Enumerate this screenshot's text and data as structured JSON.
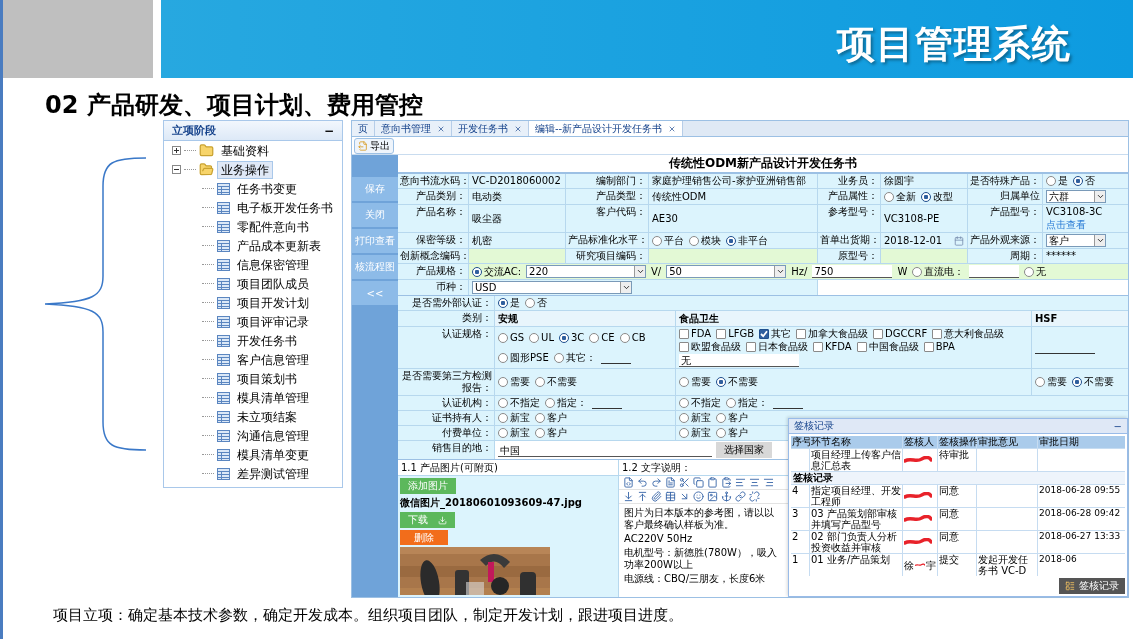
{
  "slide": {
    "banner_title": "项目管理系统",
    "heading": "02 产品研发、项目计划、费用管控",
    "caption": "项目立项：确定基本技术参数，确定开发成本。组织项目团队，制定开发计划，跟进项目进度。"
  },
  "tree": {
    "title": "立项阶段",
    "collapse_glyph": "−",
    "items": [
      {
        "label": "基础资料",
        "expanded": false,
        "selected": false
      },
      {
        "label": "业务操作",
        "expanded": true,
        "selected": true,
        "children": [
          {
            "label": "任务书变更"
          },
          {
            "label": "电子板开发任务书"
          },
          {
            "label": "零配件意向书"
          },
          {
            "label": "产品成本更新表"
          },
          {
            "label": "信息保密管理"
          },
          {
            "label": "项目团队成员"
          },
          {
            "label": "项目开发计划"
          },
          {
            "label": "项目评审记录"
          },
          {
            "label": "开发任务书"
          },
          {
            "label": "客户信息管理"
          },
          {
            "label": "项目策划书"
          },
          {
            "label": "模具清单管理"
          },
          {
            "label": "未立项结案"
          },
          {
            "label": "沟通信息管理"
          },
          {
            "label": "模具清单变更"
          },
          {
            "label": "差异测试管理"
          }
        ]
      }
    ]
  },
  "app": {
    "tabs": [
      {
        "label": "页",
        "closable": false,
        "selected": false
      },
      {
        "label": "意向书管理",
        "closable": true,
        "selected": false
      },
      {
        "label": "开发任务书",
        "closable": true,
        "selected": false
      },
      {
        "label": "编辑--新产品设计开发任务书",
        "closable": true,
        "selected": true
      }
    ],
    "export_button": "导出",
    "title": "传统性ODM新产品设计开发任务书",
    "side_buttons": [
      "保存",
      "关闭",
      "打印查看",
      "核流程图",
      "<<"
    ],
    "field_rows": [
      [
        {
          "label": "意向书流水码：",
          "kind": "text",
          "value": "VC-D2018060002"
        },
        {
          "label": "编制部门：",
          "kind": "text",
          "value": "家庭护理销售公司-家护亚洲销售部"
        },
        {
          "label": "业务员：",
          "kind": "text",
          "value": "徐圆宇"
        },
        {
          "label": "是否特殊产品：",
          "kind": "radio",
          "options": [
            {
              "label": "是",
              "selected": false
            },
            {
              "label": "否",
              "selected": true
            }
          ]
        }
      ],
      [
        {
          "label": "产品类别：",
          "kind": "text",
          "value": "电动类"
        },
        {
          "label": "产品类型：",
          "kind": "text",
          "value": "传统性ODM"
        },
        {
          "label": "产品属性：",
          "kind": "radio",
          "options": [
            {
              "label": "全新",
              "selected": false
            },
            {
              "label": "改型",
              "selected": true
            }
          ]
        },
        {
          "label": "归属单位",
          "kind": "select",
          "value": "六群"
        }
      ],
      [
        {
          "label": "产品名称：",
          "kind": "text",
          "value": "吸尘器"
        },
        {
          "label": "客户代码：",
          "kind": "text",
          "value": "AE30"
        },
        {
          "label": "参考型号：",
          "kind": "text",
          "value": "VC3108-PE"
        },
        {
          "label": "产品型号：",
          "kind": "text",
          "value": "VC3108-3C",
          "link": "点击查看"
        }
      ],
      [
        {
          "label": "保密等级：",
          "kind": "text",
          "value": "机密"
        },
        {
          "label": "产品标准化水平：",
          "kind": "radio",
          "options": [
            {
              "label": "平台",
              "selected": false
            },
            {
              "label": "模块",
              "selected": false
            },
            {
              "label": "非平台",
              "selected": true
            }
          ]
        },
        {
          "label": "首单出货期：",
          "kind": "date",
          "value": "2018-12-01"
        },
        {
          "label": "产品外观来源：",
          "kind": "select",
          "value": "客户"
        }
      ],
      [
        {
          "label": "创新概念编码：",
          "kind": "text"
        },
        {
          "label": "研究项目编码：",
          "kind": "text"
        },
        {
          "label": "原型号：",
          "kind": "text"
        },
        {
          "label": "周期：",
          "kind": "text",
          "value": "******"
        }
      ]
    ],
    "spec": {
      "label": "产品规格：",
      "ac": {
        "label": "交流AC:",
        "selected": true
      },
      "voltage": "220",
      "volt_unit": "V/",
      "frequency": "50",
      "freq_unit": "Hz/",
      "power": "750",
      "power_unit": "W",
      "dc": {
        "label": "直流电：",
        "selected": false
      },
      "none": {
        "label": "无",
        "selected": false
      }
    },
    "currency": {
      "label": "币种：",
      "value": "USD"
    },
    "certification": {
      "external": {
        "label": "是否需外部认证：",
        "options": [
          {
            "label": "是",
            "selected": true
          },
          {
            "label": "否",
            "selected": false
          }
        ]
      },
      "category_label": "类别：",
      "columns": [
        "安规",
        "食品卫生",
        "HSF"
      ],
      "rows": [
        {
          "label": "认证规格：",
          "cells": [
            {
              "kind": "radio",
              "options": [
                {
                  "label": "GS",
                  "selected": false
                },
                {
                  "label": "UL",
                  "selected": false
                },
                {
                  "label": "3C",
                  "selected": true
                },
                {
                  "label": "CE",
                  "selected": false
                },
                {
                  "label": "CB",
                  "selected": false
                },
                {
                  "label": "圆形PSE",
                  "selected": false
                },
                {
                  "label": "其它：",
                  "selected": false
                }
              ],
              "line": true
            },
            {
              "kind": "check",
              "options": [
                {
                  "label": "FDA",
                  "checked": false
                },
                {
                  "label": "LFGB",
                  "checked": false
                },
                {
                  "label": "其它",
                  "checked": true
                },
                {
                  "label": "加拿大食品级",
                  "checked": false
                },
                {
                  "label": "DGCCRF",
                  "checked": false
                },
                {
                  "label": "意大利食品级",
                  "checked": false
                },
                {
                  "label": "欧盟食品级",
                  "checked": false
                },
                {
                  "label": "日本食品级",
                  "checked": false
                },
                {
                  "label": "KFDA",
                  "checked": false
                },
                {
                  "label": "中国食品级",
                  "checked": false
                },
                {
                  "label": "BPA",
                  "checked": false
                }
              ],
              "note": "无"
            },
            {
              "kind": "line"
            }
          ]
        },
        {
          "label": "是否需要第三方检测报告：",
          "cells": [
            {
              "kind": "radio",
              "options": [
                {
                  "label": "需要",
                  "selected": false
                },
                {
                  "label": "不需要",
                  "selected": false
                }
              ]
            },
            {
              "kind": "radio",
              "options": [
                {
                  "label": "需要",
                  "selected": false
                },
                {
                  "label": "不需要",
                  "selected": true
                }
              ]
            },
            {
              "kind": "radio",
              "options": [
                {
                  "label": "需要",
                  "selected": false
                },
                {
                  "label": "不需要",
                  "selected": true
                }
              ]
            }
          ]
        },
        {
          "label": "认证机构：",
          "cells": [
            {
              "kind": "radio",
              "options": [
                {
                  "label": "不指定",
                  "selected": false
                },
                {
                  "label": "指定：",
                  "selected": false
                }
              ],
              "line": true
            },
            {
              "kind": "radio",
              "options": [
                {
                  "label": "不指定",
                  "selected": false
                },
                {
                  "label": "指定：",
                  "selected": false
                }
              ],
              "line": true
            },
            {
              "kind": "blank"
            }
          ]
        },
        {
          "label": "证书持有人：",
          "cells": [
            {
              "kind": "radio",
              "options": [
                {
                  "label": "新宝",
                  "selected": false
                },
                {
                  "label": "客户",
                  "selected": false
                }
              ]
            },
            {
              "kind": "radio",
              "options": [
                {
                  "label": "新宝",
                  "selected": false
                },
                {
                  "label": "客户",
                  "selected": false
                }
              ]
            },
            {
              "kind": "blank"
            }
          ]
        },
        {
          "label": "付费单位：",
          "cells": [
            {
              "kind": "radio",
              "options": [
                {
                  "label": "新宝",
                  "selected": false
                },
                {
                  "label": "客户",
                  "selected": false
                }
              ]
            },
            {
              "kind": "radio",
              "options": [
                {
                  "label": "新宝",
                  "selected": false
                },
                {
                  "label": "客户",
                  "selected": false
                }
              ]
            },
            {
              "kind": "blank"
            }
          ]
        }
      ],
      "destination": {
        "label": "销售目的地：",
        "value": "中国",
        "button": "选择国家"
      }
    },
    "attachments": {
      "heading": "1.1 产品图片(可附页)",
      "add_button": "添加图片",
      "file_name": "微信图片_20180601093609-47.jpg",
      "download_button": "下载",
      "delete_button": "删除"
    },
    "description": {
      "heading": "1.2 文字说明：",
      "paragraphs": [
        "图片为日本版本的参考图，请以以客户最终确认样板为准。",
        "AC220V 50Hz",
        "电机型号：新德胜(780W），吸入功率200W以上",
        "电源线：CBQ/三朋友，长度6米"
      ]
    },
    "approval": {
      "title": "签核记录",
      "collapse_glyph": "−",
      "columns": [
        "序号",
        "环节名称",
        "签核人",
        "签核操作",
        "审批意见",
        "审批日期"
      ],
      "pending": [
        {
          "step": "项目经理上传客户信息汇总表",
          "redacted": true,
          "action": "待审批"
        }
      ],
      "group_title": "签核记录",
      "rows": [
        {
          "no": "4",
          "step": "指定项目经理、开发工程师",
          "redacted": true,
          "action": "同意",
          "date": "2018-06-28 09:55"
        },
        {
          "no": "3",
          "step": "03 产品策划部审核并填写产品型号",
          "redacted": true,
          "action": "同意",
          "date": "2018-06-28 09:42"
        },
        {
          "no": "2",
          "step": "02 部门负责人分析投资收益并审核",
          "redacted": true,
          "action": "同意",
          "date": "2018-06-27 13:33"
        },
        {
          "no": "1",
          "step": "01 业务/产品策划",
          "signer_parts": [
            "徐",
            "宇"
          ],
          "redacted": true,
          "action": "提交",
          "comment": "发起开发任务书 VC-D",
          "date": "2018-06"
        }
      ],
      "float_button": "签核记录"
    }
  }
}
